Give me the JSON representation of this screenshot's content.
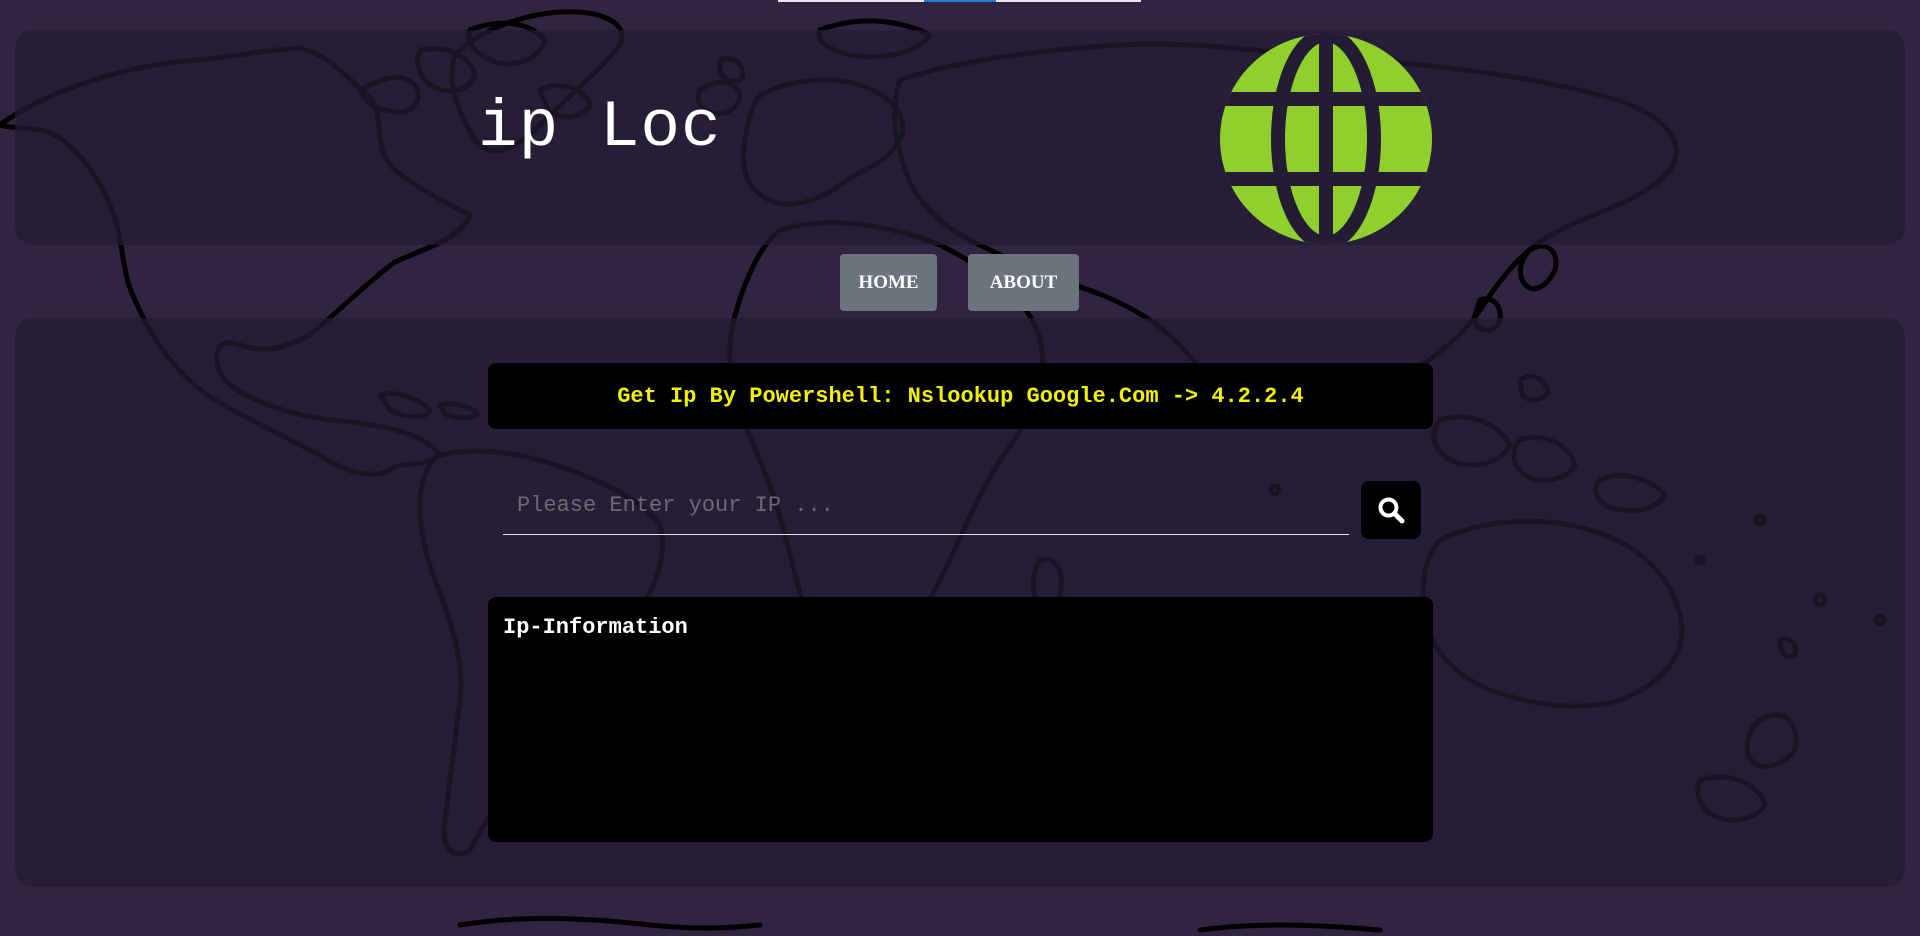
{
  "header": {
    "title": "ip Loc",
    "logo_icon": "globe-icon"
  },
  "nav": {
    "items": [
      {
        "label": "HOME"
      },
      {
        "label": "ABOUT"
      }
    ]
  },
  "main": {
    "hint": "Get Ip By Powershell: Nslookup Google.Com -> 4.2.2.4",
    "search": {
      "placeholder": "Please Enter your IP ...",
      "value": "",
      "button_icon": "search-icon"
    },
    "info": {
      "title": "Ip-Information"
    }
  },
  "colors": {
    "page_background": "#302440",
    "panel_background": "#231c32",
    "accent_globe": "#8fd02e",
    "hint_text": "#f2f200",
    "nav_button": "#6b737d",
    "top_indicator": "#e8e8e8",
    "top_indicator_active": "#1e7ad6"
  }
}
